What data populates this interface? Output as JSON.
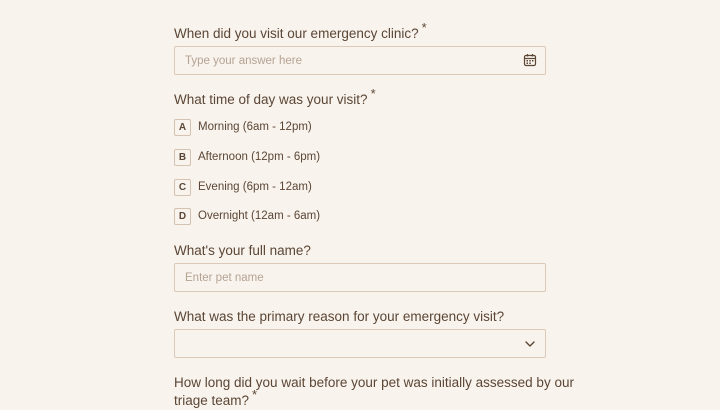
{
  "questions": {
    "visit_date": {
      "label": "When did you visit our emergency clinic?",
      "required_mark": "*",
      "placeholder": "Type your answer here",
      "icon": "calendar-icon"
    },
    "visit_time": {
      "label": "What time of day was your visit?",
      "required_mark": "*",
      "options": [
        {
          "key": "A",
          "label": "Morning (6am - 12pm)"
        },
        {
          "key": "B",
          "label": "Afternoon (12pm - 6pm)"
        },
        {
          "key": "C",
          "label": "Evening (6pm - 12am)"
        },
        {
          "key": "D",
          "label": "Overnight (12am - 6am)"
        }
      ]
    },
    "full_name": {
      "label": "What's your full name?",
      "placeholder": "Enter pet name"
    },
    "primary_reason": {
      "label": "What was the primary reason for your emergency visit?",
      "selected_value": "",
      "icon": "chevron-down-icon"
    },
    "wait_time": {
      "label_line1": "How long did you wait before your pet was initially assessed by our",
      "label_line2": "triage team?",
      "required_mark": "*"
    }
  },
  "colors": {
    "background": "#f8f3ec",
    "text": "#5b4636",
    "border": "#dcc9b8",
    "placeholder": "#b5a394"
  }
}
